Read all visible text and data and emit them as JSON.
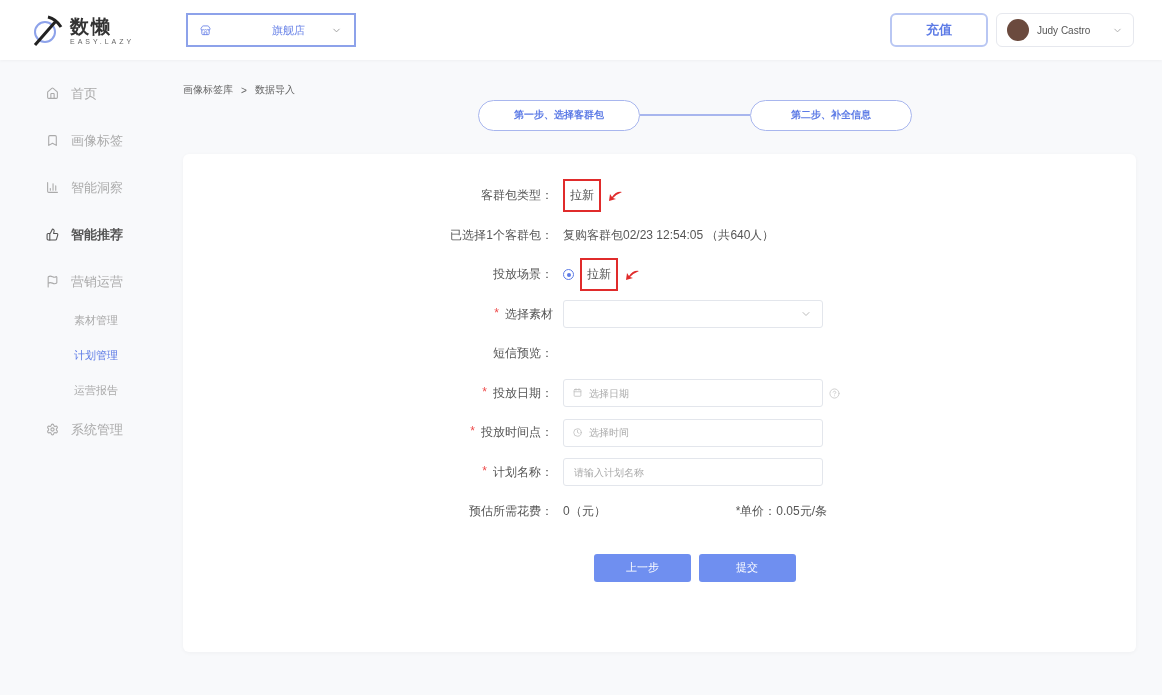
{
  "header": {
    "logo": {
      "name": "数懒",
      "tagline": "EASY.LAZY"
    },
    "store_selector": {
      "value": "旗舰店"
    },
    "recharge_button": "充值",
    "user": {
      "name": "Judy Castro"
    }
  },
  "sidebar": {
    "items": [
      {
        "label": "首页",
        "selected": false
      },
      {
        "label": "画像标签",
        "selected": false
      },
      {
        "label": "智能洞察",
        "selected": false
      },
      {
        "label": "智能推荐",
        "selected": true
      },
      {
        "label": "营销运营",
        "selected": false,
        "children": [
          {
            "label": "素材管理",
            "selected": false
          },
          {
            "label": "计划管理",
            "selected": true
          },
          {
            "label": "运营报告",
            "selected": false
          }
        ]
      },
      {
        "label": "系统管理",
        "selected": false
      }
    ]
  },
  "breadcrumb": {
    "items": [
      "画像标签库",
      "数据导入"
    ],
    "separator": ">"
  },
  "steps": [
    {
      "label": "第一步、选择客群包"
    },
    {
      "label": "第二步、补全信息"
    }
  ],
  "form": {
    "rows": [
      {
        "kind": "text",
        "label": "客群包类型：",
        "value": "拉新",
        "annotated": true
      },
      {
        "kind": "text",
        "label": "已选择1个客群包：",
        "value": "复购客群包02/23 12:54:05 （共640人）",
        "annotated": false
      },
      {
        "kind": "radio",
        "label": "投放场景：",
        "options": [
          {
            "label": "拉新",
            "selected": true
          }
        ],
        "annotated": true
      },
      {
        "kind": "select",
        "label": "选择素材",
        "marker": "*"
      },
      {
        "kind": "label",
        "label": "短信预览："
      },
      {
        "kind": "date",
        "label": "投放日期：",
        "marker": "*",
        "placeholder": "选择日期",
        "help": true
      },
      {
        "kind": "time",
        "label": "投放时间点：",
        "marker": "*",
        "placeholder": "选择时间"
      },
      {
        "kind": "input",
        "label": "计划名称：",
        "marker": "*",
        "placeholder": "请输入计划名称"
      },
      {
        "kind": "cost",
        "label": "预估所需花费：",
        "value": "0（元）",
        "note": "*单价：0.05元/条"
      }
    ]
  },
  "buttons": [
    {
      "label": "上一步"
    },
    {
      "label": "提交"
    }
  ]
}
